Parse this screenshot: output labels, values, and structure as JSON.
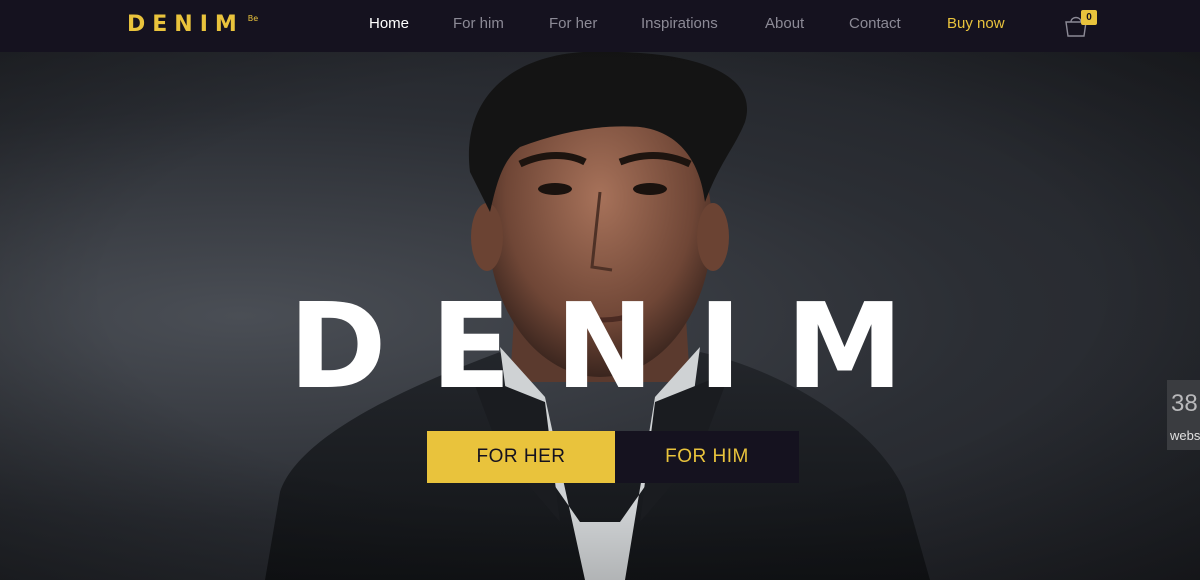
{
  "brand": {
    "logo": "DEN%IM",
    "logo_display": "DENIM",
    "sup": "Be"
  },
  "nav": {
    "items": [
      {
        "label": "Home"
      },
      {
        "label": "For him"
      },
      {
        "label": "For her"
      },
      {
        "label": "Inspirations"
      },
      {
        "label": "About"
      },
      {
        "label": "Contact"
      },
      {
        "label": "Buy now"
      }
    ],
    "cart_icon": "cart-bag-icon",
    "cart_count": "0"
  },
  "hero": {
    "title": "DENIM",
    "buttons": {
      "her": "FOR HER",
      "him": "FOR HIM"
    }
  },
  "side_widget": {
    "number": "38",
    "text": "webs"
  },
  "colors": {
    "accent": "#e9c33c",
    "dark": "#15121f",
    "nav_text": "#8c8a96"
  }
}
